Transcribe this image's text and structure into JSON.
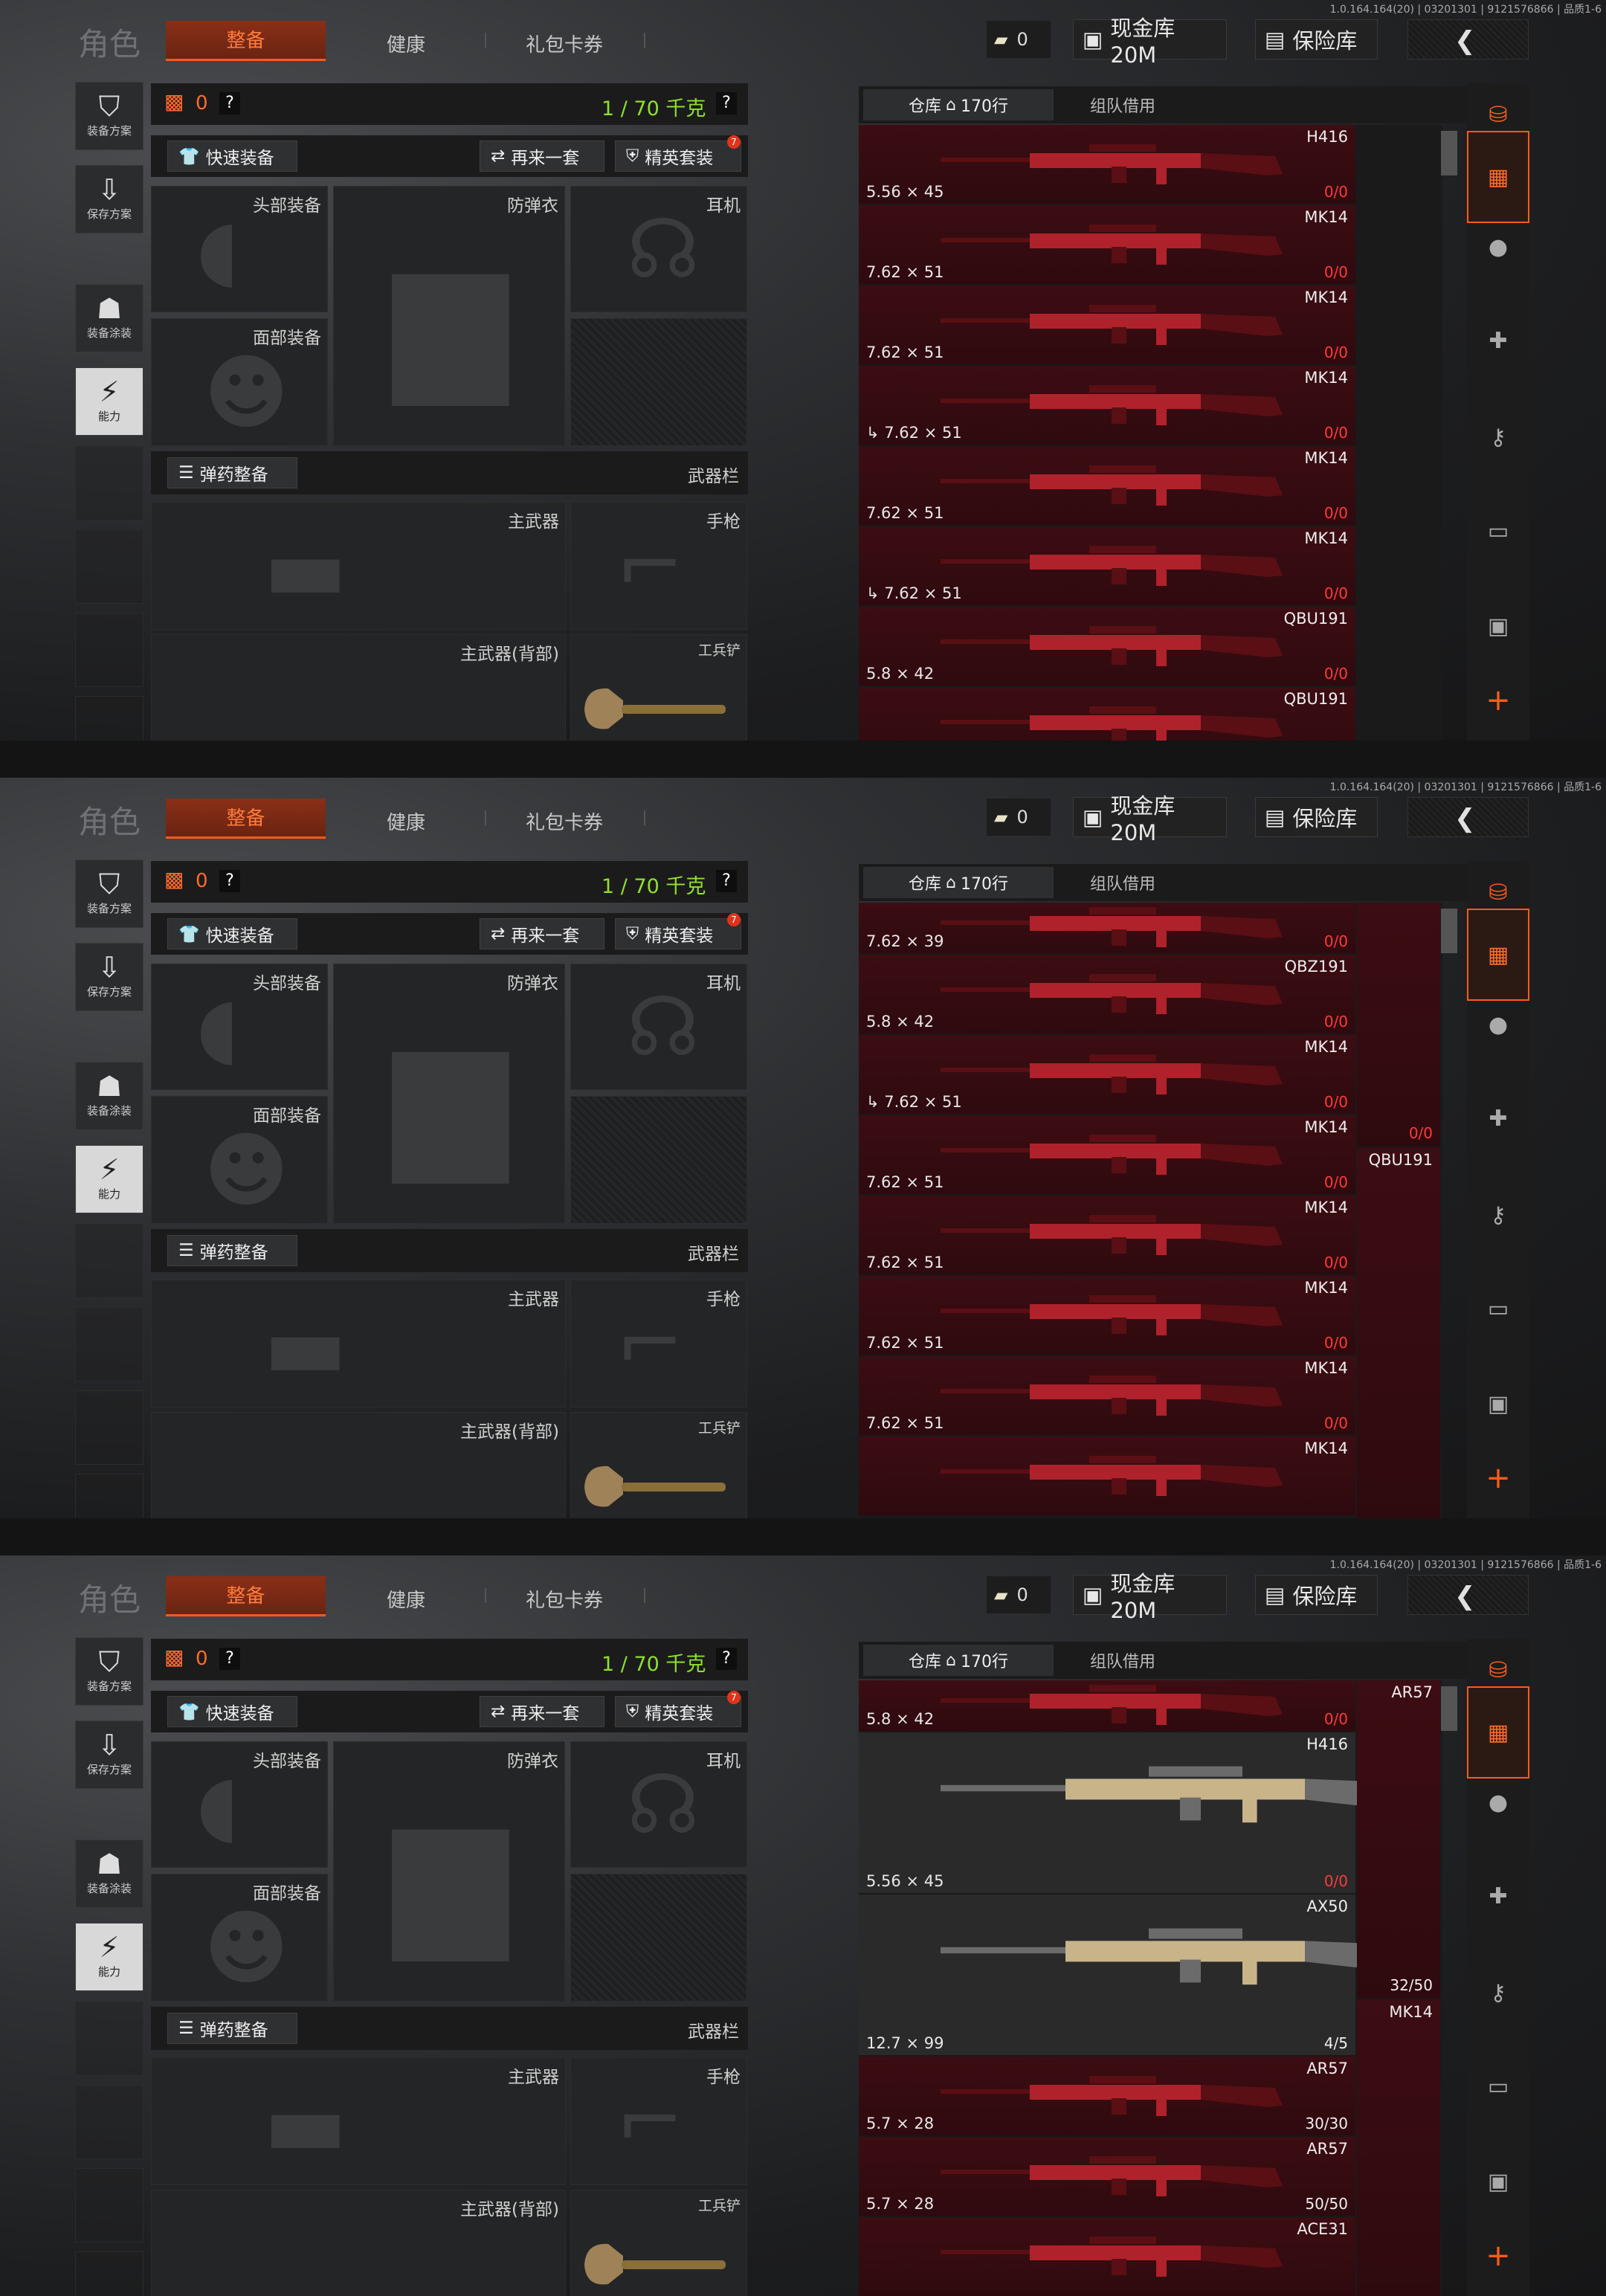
{
  "frames": [
    {
      "build": "1.0.164.164(20) | 03201301 | 9121576866 | 品质1-6",
      "title": "角色",
      "tabs": [
        "整备",
        "健康",
        "礼包卡券"
      ],
      "currency": "0",
      "vault_btn": "现金库 20M",
      "safe_btn": "保险库",
      "nav": [
        "装备方案",
        "保存方案",
        "装备涂装",
        "能力"
      ],
      "armor_count": "0",
      "weight": "1 / 70 千克",
      "quick_equip": "快速装备",
      "again_btn": "再来一套",
      "elite_btn": "精英套装",
      "elite_badge": "7",
      "slots": {
        "head": "头部装备",
        "vest": "防弹衣",
        "ear": "耳机",
        "face": "面部装备",
        "weapon_bar": "武器栏",
        "primary": "主武器",
        "pistol": "手枪",
        "primary_back": "主武器(背部)",
        "shovel": "工兵铲"
      },
      "ammo_btn": "弹药整备",
      "store_tabs": {
        "warehouse": "仓库",
        "rows": "170行",
        "team": "组队借用"
      },
      "rows": [
        {
          "name": "H416",
          "cal": "5.56 × 45",
          "cnt": "0/0",
          "icon": ""
        },
        {
          "name": "MK14",
          "cal": "7.62 × 51",
          "cnt": "0/0",
          "icon": ""
        },
        {
          "name": "MK14",
          "cal": "7.62 × 51",
          "cnt": "0/0",
          "icon": ""
        },
        {
          "name": "MK14",
          "cal": "7.62 × 51",
          "cnt": "0/0",
          "icon": "↳"
        },
        {
          "name": "MK14",
          "cal": "7.62 × 51",
          "cnt": "0/0",
          "icon": ""
        },
        {
          "name": "MK14",
          "cal": "7.62 × 51",
          "cnt": "0/0",
          "icon": "↳"
        },
        {
          "name": "QBU191",
          "cal": "5.8 × 42",
          "cnt": "0/0",
          "icon": ""
        },
        {
          "name": "QBU191",
          "cal": "",
          "cnt": "",
          "icon": ""
        }
      ],
      "talls": []
    },
    {
      "build": "1.0.164.164(20) | 03201301 | 9121576866 | 品质1-6",
      "title": "角色",
      "tabs": [
        "整备",
        "健康",
        "礼包卡券"
      ],
      "currency": "0",
      "vault_btn": "现金库 20M",
      "safe_btn": "保险库",
      "nav": [
        "装备方案",
        "保存方案",
        "装备涂装",
        "能力"
      ],
      "armor_count": "0",
      "weight": "1 / 70 千克",
      "quick_equip": "快速装备",
      "again_btn": "再来一套",
      "elite_btn": "精英套装",
      "elite_badge": "7",
      "slots": {
        "head": "头部装备",
        "vest": "防弹衣",
        "ear": "耳机",
        "face": "面部装备",
        "weapon_bar": "武器栏",
        "primary": "主武器",
        "pistol": "手枪",
        "primary_back": "主武器(背部)",
        "shovel": "工兵铲"
      },
      "ammo_btn": "弹药整备",
      "store_tabs": {
        "warehouse": "仓库",
        "rows": "170行",
        "team": "组队借用"
      },
      "rows": [
        {
          "name": "",
          "cal": "7.62 × 39",
          "cnt": "0/0",
          "icon": "",
          "short": true
        },
        {
          "name": "QBZ191",
          "cal": "5.8 × 42",
          "cnt": "0/0",
          "icon": ""
        },
        {
          "name": "MK14",
          "cal": "7.62 × 51",
          "cnt": "0/0",
          "icon": "↳"
        },
        {
          "name": "MK14",
          "cal": "7.62 × 51",
          "cnt": "0/0",
          "icon": ""
        },
        {
          "name": "MK14",
          "cal": "7.62 × 51",
          "cnt": "0/0",
          "icon": ""
        },
        {
          "name": "MK14",
          "cal": "7.62 × 51",
          "cnt": "0/0",
          "icon": ""
        },
        {
          "name": "MK14",
          "cal": "7.62 × 51",
          "cnt": "0/0",
          "icon": ""
        },
        {
          "name": "MK14",
          "cal": "",
          "cnt": "",
          "icon": ""
        }
      ],
      "talls": [
        {
          "name": "",
          "cnt": "0/0"
        },
        {
          "name": "QBU191",
          "cnt": ""
        }
      ]
    },
    {
      "build": "1.0.164.164(20) | 03201301 | 9121576866 | 品质1-6",
      "title": "角色",
      "tabs": [
        "整备",
        "健康",
        "礼包卡券"
      ],
      "currency": "0",
      "vault_btn": "现金库 20M",
      "safe_btn": "保险库",
      "nav": [
        "装备方案",
        "保存方案",
        "装备涂装",
        "能力"
      ],
      "armor_count": "0",
      "weight": "1 / 70 千克",
      "quick_equip": "快速装备",
      "again_btn": "再来一套",
      "elite_btn": "精英套装",
      "elite_badge": "7",
      "slots": {
        "head": "头部装备",
        "vest": "防弹衣",
        "ear": "耳机",
        "face": "面部装备",
        "weapon_bar": "武器栏",
        "primary": "主武器",
        "pistol": "手枪",
        "primary_back": "主武器(背部)",
        "shovel": "工兵铲"
      },
      "ammo_btn": "弹药整备",
      "store_tabs": {
        "warehouse": "仓库",
        "rows": "170行",
        "team": "组队借用"
      },
      "rows": [
        {
          "name": "",
          "cal": "5.8 × 42",
          "cnt": "0/0",
          "icon": "",
          "short": true
        },
        {
          "name": "H416",
          "cal": "5.56 × 45",
          "cnt": "0/0",
          "icon": "",
          "gold": true,
          "big": true
        },
        {
          "name": "AX50",
          "cal": "12.7 × 99",
          "cnt": "4/5",
          "icon": "",
          "gold": true,
          "big": true,
          "white": true
        },
        {
          "name": "AR57",
          "cal": "5.7 × 28",
          "cnt": "30/30",
          "icon": "",
          "white": true
        },
        {
          "name": "AR57",
          "cal": "5.7 × 28",
          "cnt": "50/50",
          "icon": "",
          "white": true
        },
        {
          "name": "ACE31",
          "cal": "",
          "cnt": "",
          "icon": ""
        }
      ],
      "talls": [
        {
          "name": "AR57",
          "cnt": "32/50",
          "white": true
        },
        {
          "name": "MK14",
          "cnt": ""
        }
      ]
    }
  ],
  "rail_icons": [
    "stack-icon",
    "backpack-icon",
    "grenade-icon",
    "medkit-icon",
    "key-icon",
    "cash-icon",
    "box-icon",
    "add-icon"
  ],
  "colors": {
    "accent": "#ff5a1a",
    "weight_green": "#8ee02e",
    "count_red": "#ff3a3a",
    "row_red": "#3c0d12"
  }
}
